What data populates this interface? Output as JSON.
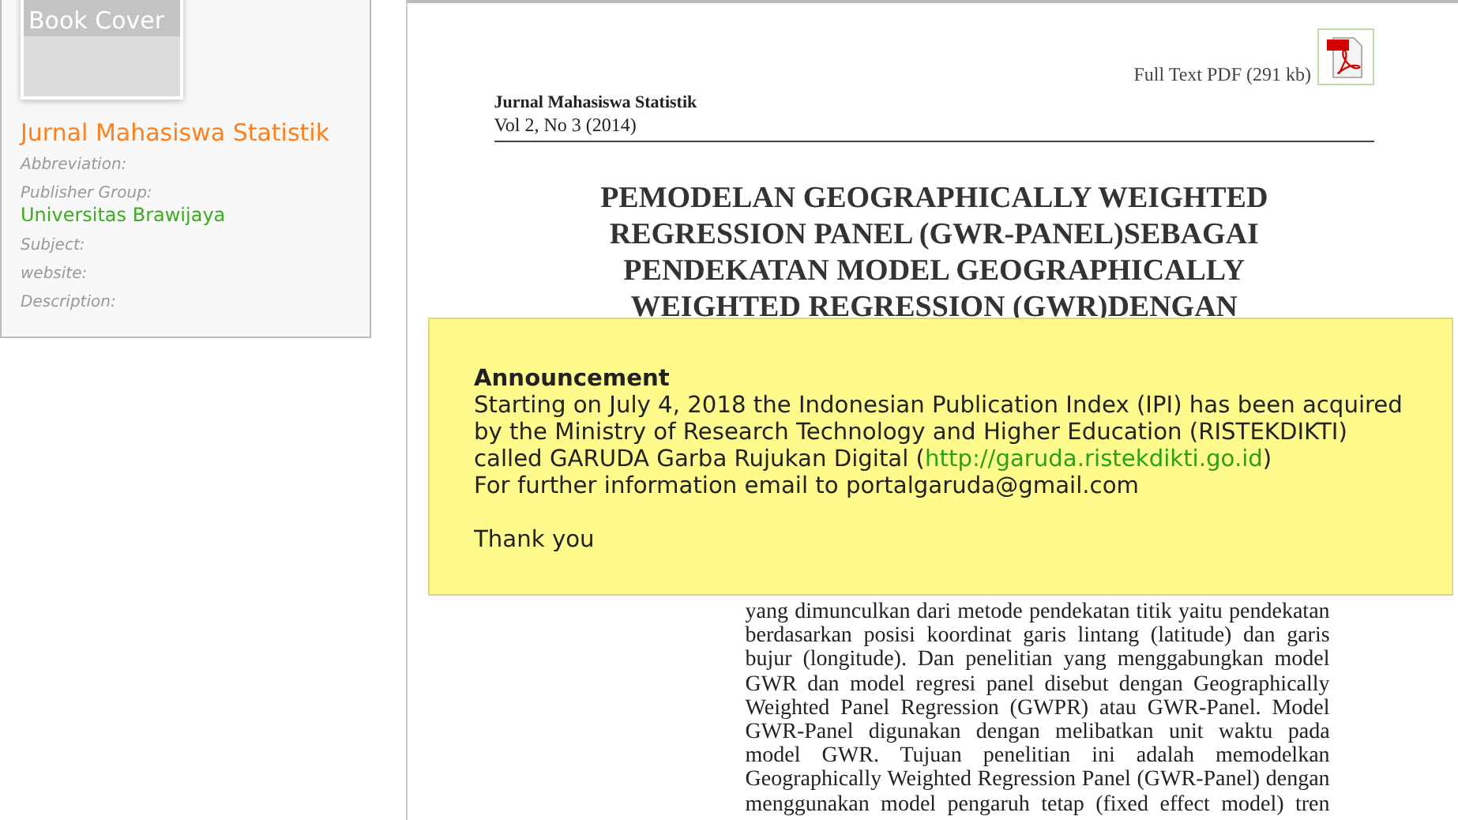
{
  "sidebar": {
    "cover_label": "Book Cover",
    "journal_title": "Jurnal Mahasiswa Statistik",
    "fields": [
      {
        "label": "Abbreviation:"
      },
      {
        "label": "Publisher Group:",
        "value": "Universitas Brawijaya"
      },
      {
        "label": "Subject:"
      },
      {
        "label": "website:"
      },
      {
        "label": "Description:"
      }
    ]
  },
  "article": {
    "pdf_link": "Full Text PDF (291 kb)",
    "journal": "Jurnal Mahasiswa Statistik",
    "issue": "Vol 2, No 3 (2014)",
    "title": "PEMODELAN GEOGRAPHICALLY WEIGHTED REGRESSION PANEL (GWR-PANEL)SEBAGAI PENDEKATAN MODEL GEOGRAPHICALLY WEIGHTED REGRESSION (GWR)DENGAN",
    "abstract_text": "yang dimunculkan dari metode pendekatan titik yaitu pendekatan berdasarkan posisi koordinat garis lintang (latitude) dan garis bujur (longitude). Dan penelitian yang menggabungkan model GWR dan model regresi panel disebut dengan Geographically Weighted Panel Regression (GWPR) atau GWR-Panel. Model GWR-Panel digunakan dengan melibatkan unit waktu pada model GWR. Tujuan penelitian ini adalah memodelkan Geographically Weighted Regression Panel (GWR-Panel) dengan menggunakan model pengaruh tetap (fixed effect model) tren"
  },
  "announcement": {
    "title": "Announcement",
    "text_before": "Starting on July 4, 2018 the Indonesian Publication Index (IPI) has been acquired by the Ministry of Research Technology and Higher Education (RISTEKDIKTI) called GARUDA Garba Rujukan Digital (",
    "link": "http://garuda.ristekdikti.go.id",
    "text_after": ")",
    "email_line": "For further information email to portalgaruda@gmail.com",
    "closing": "Thank you"
  }
}
